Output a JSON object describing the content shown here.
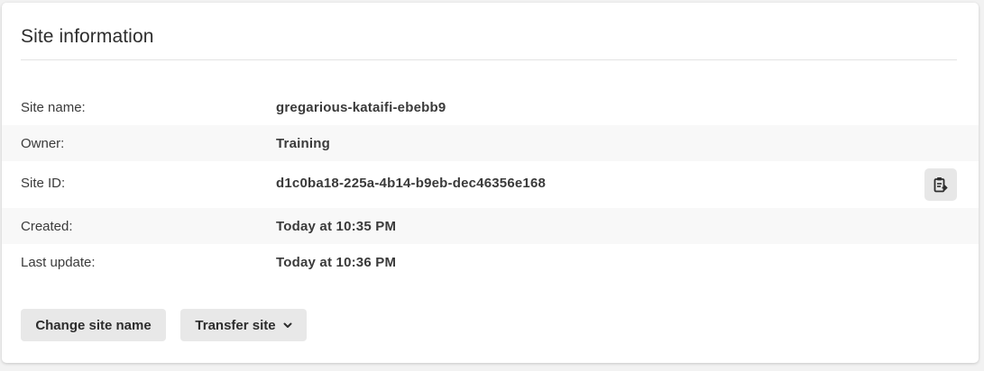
{
  "card": {
    "title": "Site information"
  },
  "rows": [
    {
      "label": "Site name:",
      "value": "gregarious-kataifi-ebebb9"
    },
    {
      "label": "Owner:",
      "value": "Training"
    },
    {
      "label": "Site ID:",
      "value": "d1c0ba18-225a-4b14-b9eb-dec46356e168",
      "action_icon": "copy-clipboard-icon"
    },
    {
      "label": "Created:",
      "value": "Today at 10:35 PM"
    },
    {
      "label": "Last update:",
      "value": "Today at 10:36 PM"
    }
  ],
  "actions": {
    "change_site_name": "Change site name",
    "transfer_site": "Transfer site",
    "transfer_icon": "chevron-down-icon"
  },
  "colors": {
    "card_background": "#ffffff",
    "page_background": "#f2f2f2",
    "shaded_row": "#f8f8f8",
    "button_background": "#e8e8e8",
    "text": "#2d2d2d"
  }
}
